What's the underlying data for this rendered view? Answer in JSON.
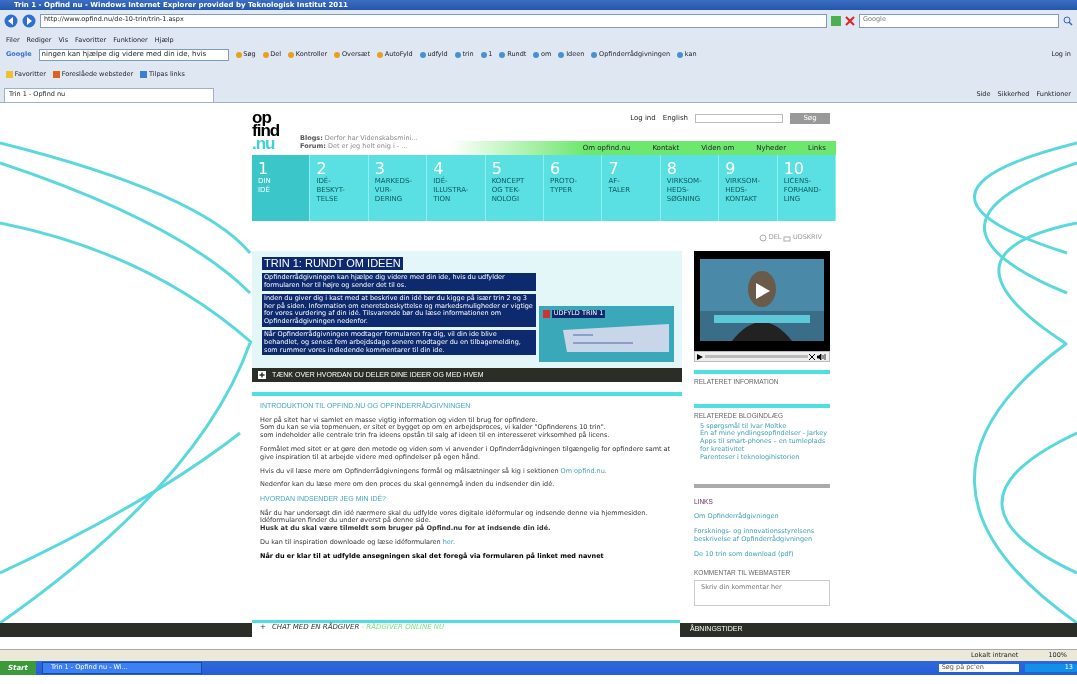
{
  "browser": {
    "title": "Trin 1 - Opfind nu - Windows Internet Explorer provided by Teknologisk Institut 2011",
    "address": "http://www.opfind.nu/de-10-trin/trin-1.aspx",
    "search_placeholder": "Google",
    "menu": [
      "Filer",
      "Rediger",
      "Vis",
      "Favoritter",
      "Funktioner",
      "Hjælp"
    ],
    "google_label": "Google",
    "google_query": "ningen kan hjælpe dig videre med din ide, hvis",
    "toolbar": [
      "Søg",
      "Del",
      "Kontroller",
      "Oversæt",
      "AutoFyld",
      "udfyld",
      "trin",
      "1",
      "Rundt",
      "om",
      "Ideen",
      "Opfinderrådgivningen",
      "kan"
    ],
    "login": "Log in",
    "favorites": [
      "Favoritter",
      "Foreslåede websteder",
      "Tilpas links"
    ],
    "tab": "Trin 1 - Opfind nu",
    "commands": [
      "Side",
      "Sikkerhed",
      "Funktioner"
    ]
  },
  "site": {
    "logo": [
      "op",
      "find",
      ".nu"
    ],
    "top_links": [
      "Log ind",
      "English"
    ],
    "search_button": "Søg",
    "blogs": {
      "label": "Blogs:",
      "text": "Derfor har Videnskabsmini..."
    },
    "forum": {
      "label": "Forum:",
      "text": "Det er jeg helt enig i - ..."
    },
    "nav": [
      "Om opfind.nu",
      "Kontakt",
      "Viden om",
      "Nyheder",
      "Links"
    ],
    "steps": [
      {
        "number": "1",
        "label": "DIN\nIDÉ",
        "selected": true
      },
      {
        "number": "2",
        "label": "IDÉ-\nBESKYT-\nTELSE",
        "selected": false
      },
      {
        "number": "3",
        "label": "MARKEDS-\nVUR-\nDERING",
        "selected": false
      },
      {
        "number": "4",
        "label": "IDÉ-\nILLUSTRA-\nTION",
        "selected": false
      },
      {
        "number": "5",
        "label": "KONCEPT\nOG TEK-\nNOLOGI",
        "selected": false
      },
      {
        "number": "6",
        "label": "PROTO-\nTYPER",
        "selected": false
      },
      {
        "number": "7",
        "label": "AF-\nTALER",
        "selected": false
      },
      {
        "number": "8",
        "label": "VIRKSOM-\nHEDS-\nSØGNING",
        "selected": false
      },
      {
        "number": "9",
        "label": "VIRKSOM-\nHEDS-\nKONTAKT",
        "selected": false
      },
      {
        "number": "10",
        "label": "LICENS-\nFORHAND-\nLING",
        "selected": false
      }
    ],
    "share": "DEL",
    "print": "UDSKRIV"
  },
  "intro": {
    "title": "TRIN 1: RUNDT OM IDEEN",
    "highlighted": true,
    "paragraphs": [
      "Opfinderrådgivningen kan hjælpe dig videre med din ide, hvis du udfylder formularen her til højre og sender det til os.",
      "Inden du giver dig i kast med at  beskrive din idé bør du kigge på især trin 2 og 3 her på siden. Information om eneretsbeskyttelse og markedsmuligheder er vigtige for vores vurdering af din idé. Tilsvarende bør du læse informationen om Opfinderrådgivningen nedenfor.",
      "Når Opfinderrådgivningen modtager formularen fra dig, vil din ide blive behandlet, og senest fem arbejdsdage senere modtager du en tilbagemelding, som rummer vores indledende kommentarer til din ide."
    ],
    "form_link": "UDFYLD TRIN 1",
    "accordion": "TÆNK OVER HVORDAN DU DELER DINE IDEER OG MED HVEM"
  },
  "article": {
    "heading": "INTRODUKTION TIL OPFIND.NU OG OPFINDERRÅDGIVNINGEN",
    "blocks": [
      {
        "kind": "text",
        "text": "Her på sitet har vi samlet en masse vigtig information og viden til brug for opfindere.\nSom du kan se via topmenuen, er sitet er bygget op om en arbejdsproces, vi kalder \"Opfinderens 10 trin\".\nsom indeholder alle centrale trin fra ideens opstån til salg af ideen til en interesseret virksomhed på licens."
      },
      {
        "kind": "text",
        "text": "Formålet med sitet er at gøre den metode og viden som vi anvender i Opfinderrådgivningen tilgængelig for opfindere samt at  give inspiration til at arbejde videre med opfindelser på egen hånd."
      },
      {
        "kind": "text",
        "text": "Hvis du vil læse mere om Opfinderrådgivningens formål og målsætninger så kig i sektionen ",
        "link": "Om opfind.nu."
      },
      {
        "kind": "text",
        "text": "Nedenfor kan du læse mere om den proces du skal gennemgå inden du indsender din idé."
      },
      {
        "kind": "heading",
        "text": "HVORDAN INDSENDER JEG MIN IDÉ?"
      },
      {
        "kind": "text",
        "text": "Når du har undersøgt din idé nærmere skal du udfylde vores digitale idéformular og indsende denne via hjemmesiden. Idéformularen finder du under øverst på denne side.\n**Husk at du skal være tilmeldt som bruger på Opfind.nu for at indsende din idé.**"
      },
      {
        "kind": "text",
        "text": "Du kan til inspiration downloade og læse idéformularen ",
        "link": "her",
        "after": "."
      },
      {
        "kind": "bold",
        "text": "Når du er klar til at udfylde ansøgningen skal det foregå via formularen på linket med navnet"
      }
    ]
  },
  "sidebar": {
    "related": "RELATERET INFORMATION",
    "blog_heading": "RELATEREDE BLOGINDLÆG",
    "blog_posts": [
      "5 spørgsmål til Ivar Moltke",
      "Én af mine yndlingsopfindelser - Jarkey",
      "Apps til smart-phones – en tumleplads for kreativitet",
      "Parenteser i teknologihistorien"
    ],
    "links_heading": "LINKS",
    "links": [
      "Om Opfinderrådgivningen",
      "Forsknings- og innovationsstyrelsens beskrivelse af Opfinderrådgivningen",
      "De 10 trin som download (pdf)"
    ],
    "comment_heading": "KOMMENTAR TIL WEBMASTER",
    "comment_placeholder": "Skriv din kommentar her"
  },
  "footer": {
    "chat_icon": "+",
    "chat": "CHAT MED EN RÅDGIVER",
    "chat_status": " - RÅDGIVER ONLINE NU",
    "hours": "ÅBNINGSTIDER"
  },
  "status_bar": {
    "zone": "Lokalt intranet",
    "zoom": "100%"
  },
  "taskbar": {
    "start": "Start",
    "window": "Trin 1 - Opfind nu - Wi...",
    "search": "Søg på pc'en",
    "clock": "13"
  }
}
